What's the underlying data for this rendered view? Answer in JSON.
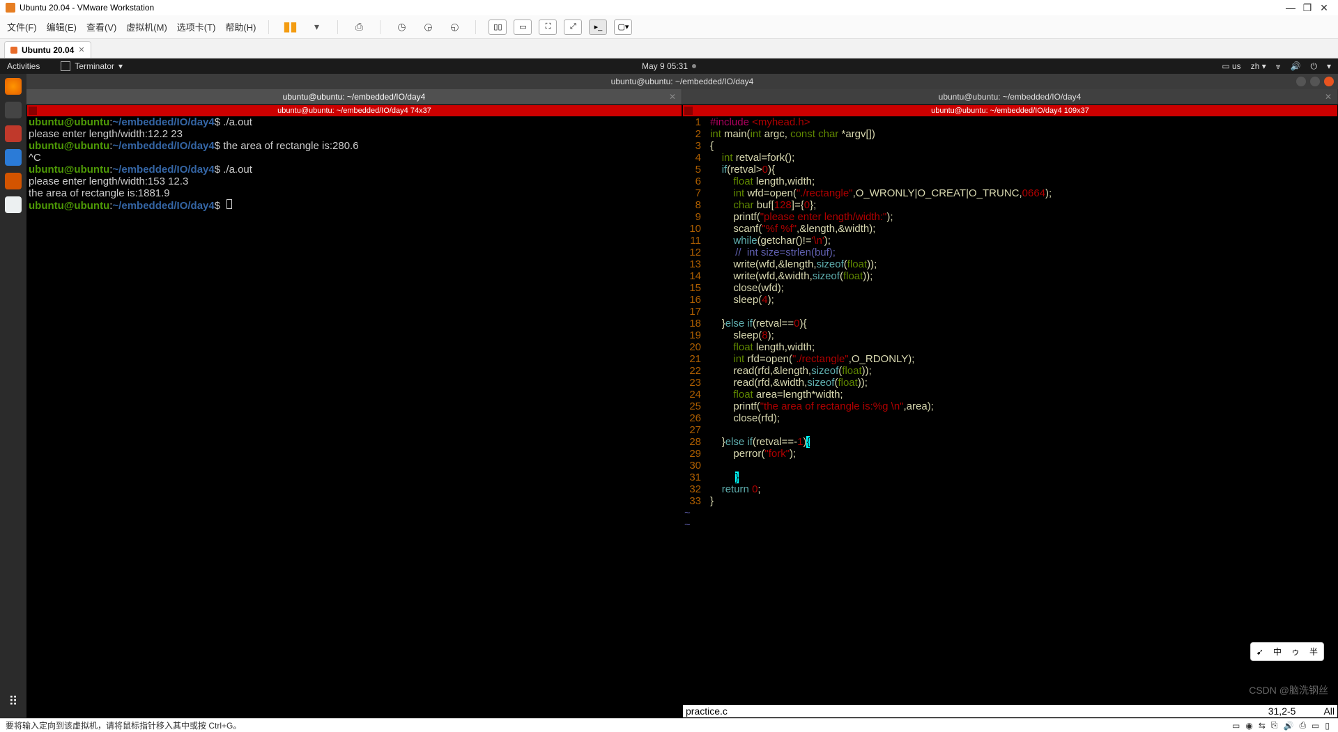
{
  "titlebar": {
    "title": "Ubuntu 20.04 - VMware Workstation"
  },
  "menubar": {
    "file": "文件(F)",
    "edit": "编辑(E)",
    "view": "查看(V)",
    "vm": "虚拟机(M)",
    "tabs": "选项卡(T)",
    "help": "帮助(H)"
  },
  "vmtab": {
    "label": "Ubuntu 20.04"
  },
  "gnome": {
    "activities": "Activities",
    "terminator": "Terminator",
    "time": "May 9  05:31",
    "lang_us": "us",
    "lang_zh": "zh"
  },
  "window_title": "ubuntu@ubuntu: ~/embedded/IO/day4",
  "tab_left": "ubuntu@ubuntu: ~/embedded/IO/day4",
  "tab_right": "ubuntu@ubuntu: ~/embedded/IO/day4",
  "pane_left_header": "ubuntu@ubuntu: ~/embedded/IO/day4 74x37",
  "pane_right_header": "ubuntu@ubuntu: ~/embedded/IO/day4 109x37",
  "prompt": {
    "user": "ubuntu@ubuntu",
    "sep": ":",
    "path": "~/embedded/IO/day4",
    "dollar": "$"
  },
  "left_terminal": {
    "cmd1": " ./a.out",
    "out1": "please enter length/width:12.2 23",
    "out2": " the area of rectangle is:280.6",
    "ctrl_c": "^C",
    "cmd2": " ./a.out",
    "out3": "please enter length/width:153 12.3",
    "out4": "the area of rectangle is:1881.9"
  },
  "code": {
    "l1_a": "#include ",
    "l1_b": "<myhead.h>",
    "l2_a": "int",
    "l2_b": " main(",
    "l2_c": "int",
    "l2_d": " argc, ",
    "l2_e": "const",
    "l2_f": " ",
    "l2_g": "char",
    "l2_h": " *argv[])",
    "l3": "{",
    "l4_a": "    ",
    "l4_b": "int",
    "l4_c": " retval=fork();",
    "l5_a": "    ",
    "l5_b": "if",
    "l5_c": "(retval>",
    "l5_d": "0",
    "l5_e": "){",
    "l6_a": "        ",
    "l6_b": "float",
    "l6_c": " length,width;",
    "l7_a": "        ",
    "l7_b": "int",
    "l7_c": " wfd=open(",
    "l7_d": "\"./rectangle\"",
    "l7_e": ",O_WRONLY|O_CREAT|O_TRUNC,",
    "l7_f": "0664",
    "l7_g": ");",
    "l8_a": "        ",
    "l8_b": "char",
    "l8_c": " buf[",
    "l8_d": "128",
    "l8_e": "]={",
    "l8_f": "0",
    "l8_g": "};",
    "l9_a": "        printf(",
    "l9_b": "\"please enter length/width:\"",
    "l9_c": ");",
    "l10_a": "        scanf(",
    "l10_b": "\"%f %f\"",
    "l10_c": ",&length,&width);",
    "l11_a": "        ",
    "l11_b": "while",
    "l11_c": "(getchar()!=",
    "l11_d": "'\\n'",
    "l11_e": ");",
    "l12_a": "//  int size=strlen(buf);",
    "l13_a": "        write(wfd,&length,",
    "l13_b": "sizeof",
    "l13_c": "(",
    "l13_d": "float",
    "l13_e": "));",
    "l14_a": "        write(wfd,&width,",
    "l14_b": "sizeof",
    "l14_c": "(",
    "l14_d": "float",
    "l14_e": "));",
    "l15": "        close(wfd);",
    "l16_a": "        sleep(",
    "l16_b": "4",
    "l16_c": ");",
    "l18_a": "    }",
    "l18_b": "else",
    "l18_c": " ",
    "l18_d": "if",
    "l18_e": "(retval==",
    "l18_f": "0",
    "l18_g": "){",
    "l19_a": "        sleep(",
    "l19_b": "8",
    "l19_c": ");",
    "l20_a": "        ",
    "l20_b": "float",
    "l20_c": " length,width;",
    "l21_a": "        ",
    "l21_b": "int",
    "l21_c": " rfd=open(",
    "l21_d": "\"./rectangle\"",
    "l21_e": ",O_RDONLY);",
    "l22_a": "        read(rfd,&length,",
    "l22_b": "sizeof",
    "l22_c": "(",
    "l22_d": "float",
    "l22_e": "));",
    "l23_a": "        read(rfd,&width,",
    "l23_b": "sizeof",
    "l23_c": "(",
    "l23_d": "float",
    "l23_e": "));",
    "l24_a": "        ",
    "l24_b": "float",
    "l24_c": " area=length*width;",
    "l25_a": "        printf(",
    "l25_b": "\"the area of rectangle is:%g \\n\"",
    "l25_c": ",area);",
    "l26": "        close(rfd);",
    "l28_a": "    }",
    "l28_b": "else",
    "l28_c": " ",
    "l28_d": "if",
    "l28_e": "(retval==-",
    "l28_f": "1",
    "l28_g": ")",
    "l28_h": "{",
    "l29_a": "        perror(",
    "l29_b": "\"fork\"",
    "l29_c": ");",
    "l31_cursor": "}",
    "l32_a": "    ",
    "l32_b": "return",
    "l32_c": " ",
    "l32_d": "0",
    "l32_e": ";",
    "l33": "}"
  },
  "vim_status": {
    "filename": "practice.c",
    "pos": "31,2-5",
    "scroll": "All"
  },
  "ime": {
    "a": "➹",
    "b": "中",
    "c": "ゥ",
    "d": "半"
  },
  "statusbar": "要将输入定向到该虚拟机，请将鼠标指针移入其中或按 Ctrl+G。",
  "watermark": "CSDN @脑洗钢丝"
}
